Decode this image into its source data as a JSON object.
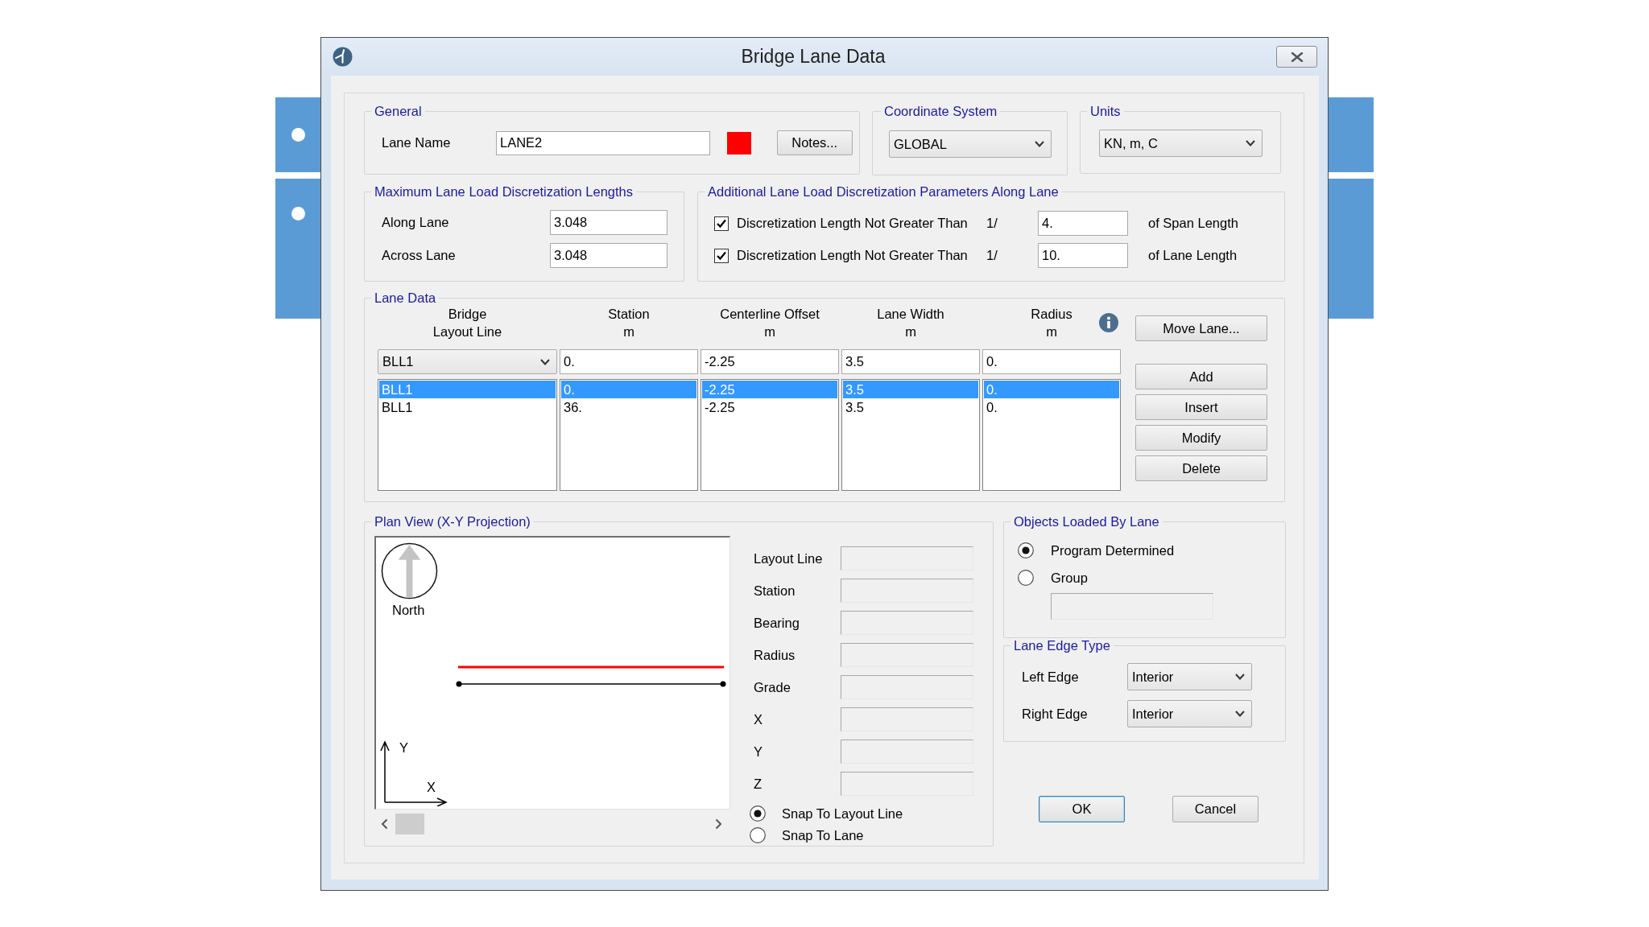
{
  "window": {
    "title": "Bridge Lane Data"
  },
  "general": {
    "title": "General",
    "lane_name_label": "Lane Name",
    "lane_name": "LANE2",
    "color": "#ff0000",
    "notes_button": "Notes..."
  },
  "coordinate_system": {
    "title": "Coordinate System",
    "value": "GLOBAL"
  },
  "units": {
    "title": "Units",
    "value": "KN, m, C"
  },
  "max_discretization": {
    "title": "Maximum Lane Load Discretization Lengths",
    "fields": [
      {
        "label": "Along Lane",
        "value": "3.048"
      },
      {
        "label": "Across Lane",
        "value": "3.048"
      }
    ]
  },
  "additional_discretization": {
    "title": "Additional Lane Load Discretization Parameters Along Lane",
    "rows": [
      {
        "checked": true,
        "label": "Discretization Length Not Greater Than",
        "prefix": "1/",
        "value": "4.",
        "suffix": "of Span Length"
      },
      {
        "checked": true,
        "label": "Discretization Length Not Greater Than",
        "prefix": "1/",
        "value": "10.",
        "suffix": "of Lane Length"
      }
    ]
  },
  "lane_data": {
    "title": "Lane Data",
    "columns": [
      {
        "label": "Bridge Layout Line",
        "kind": "dropdown"
      },
      {
        "label": "Station",
        "unit": "m",
        "kind": "text"
      },
      {
        "label": "Centerline Offset",
        "unit": "m",
        "kind": "text"
      },
      {
        "label": "Lane Width",
        "unit": "m",
        "kind": "text"
      },
      {
        "label": "Radius",
        "unit": "m",
        "kind": "text"
      }
    ],
    "edit_row": [
      "BLL1",
      "0.",
      "-2.25",
      "3.5",
      "0."
    ],
    "rows": [
      {
        "cells": [
          "BLL1",
          "0.",
          "-2.25",
          "3.5",
          "0."
        ],
        "selected": true
      },
      {
        "cells": [
          "BLL1",
          "36.",
          "-2.25",
          "3.5",
          "0."
        ],
        "selected": false
      }
    ],
    "move_button": "Move Lane...",
    "actions": [
      "Add",
      "Insert",
      "Modify",
      "Delete"
    ]
  },
  "plan_view": {
    "title": "Plan View (X-Y Projection)",
    "north_label": "North",
    "y_axis_label": "Y",
    "x_axis_label": "X",
    "fields": [
      {
        "label": "Layout Line",
        "disabled": true
      },
      {
        "label": "Station",
        "disabled": true
      },
      {
        "label": "Bearing",
        "disabled": true
      },
      {
        "label": "Radius",
        "disabled": true
      },
      {
        "label": "Grade",
        "disabled": true
      },
      {
        "label": "X",
        "disabled": true
      },
      {
        "label": "Y",
        "disabled": true
      },
      {
        "label": "Z",
        "disabled": true
      }
    ],
    "snap_options": [
      {
        "label": "Snap To Layout Line",
        "selected": true
      },
      {
        "label": "Snap To Lane",
        "selected": false
      }
    ]
  },
  "objects_loaded": {
    "title": "Objects Loaded By Lane",
    "options": [
      {
        "label": "Program Determined",
        "selected": true
      },
      {
        "label": "Group",
        "selected": false
      }
    ],
    "group_field": {
      "disabled": true
    }
  },
  "lane_edge_type": {
    "title": "Lane Edge Type",
    "edges": [
      {
        "label": "Left Edge",
        "value": "Interior"
      },
      {
        "label": "Right Edge",
        "value": "Interior"
      }
    ]
  },
  "buttons": [
    {
      "label": "OK",
      "default": true
    },
    {
      "label": "Cancel",
      "default": false
    }
  ]
}
